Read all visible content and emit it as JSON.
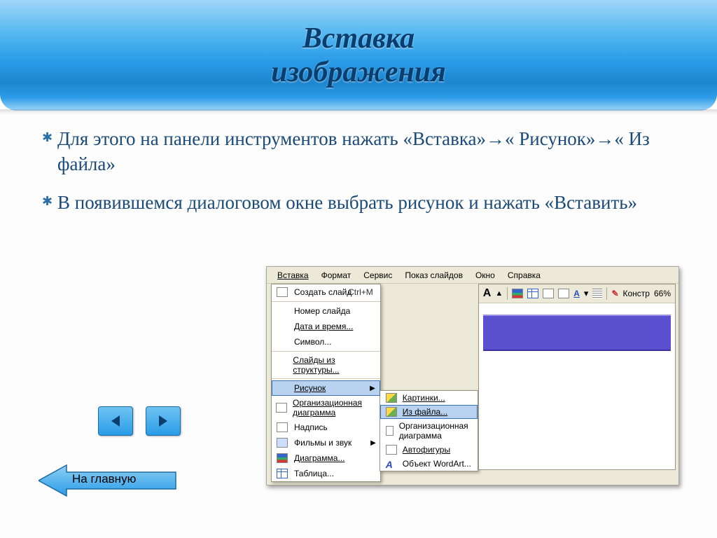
{
  "header": {
    "line1": "Вставка",
    "line2": "изображения"
  },
  "bullets": [
    "Для этого на панели инструментов нажать «Вставка»→« Рисунок»→« Из файла»",
    "В появившемся диалоговом окне выбрать рисунок и нажать «Вставить»"
  ],
  "home_button": "На главную",
  "menubar": [
    "Вставка",
    "Формат",
    "Сервис",
    "Показ слайдов",
    "Окно",
    "Справка"
  ],
  "dropdown": {
    "create_slide": "Создать слайд",
    "create_slide_shortcut": "Ctrl+M",
    "slide_number": "Номер слайда",
    "date_time": "Дата и время...",
    "symbol": "Символ...",
    "slides_from_structure": "Слайды из структуры...",
    "picture": "Рисунок",
    "org_chart": "Организационная диаграмма",
    "textbox": "Надпись",
    "movies_sound": "Фильмы и звук",
    "diagram": "Диаграмма...",
    "table": "Таблица..."
  },
  "submenu": {
    "clipart": "Картинки...",
    "from_file": "Из файла...",
    "org_diagram": "Организационная диаграмма",
    "autoshapes": "Автофигуры",
    "wordart": "Объект WordArt..."
  },
  "toolbar": {
    "font_letter": "A",
    "construct": "Констр",
    "zoom": "66%"
  }
}
